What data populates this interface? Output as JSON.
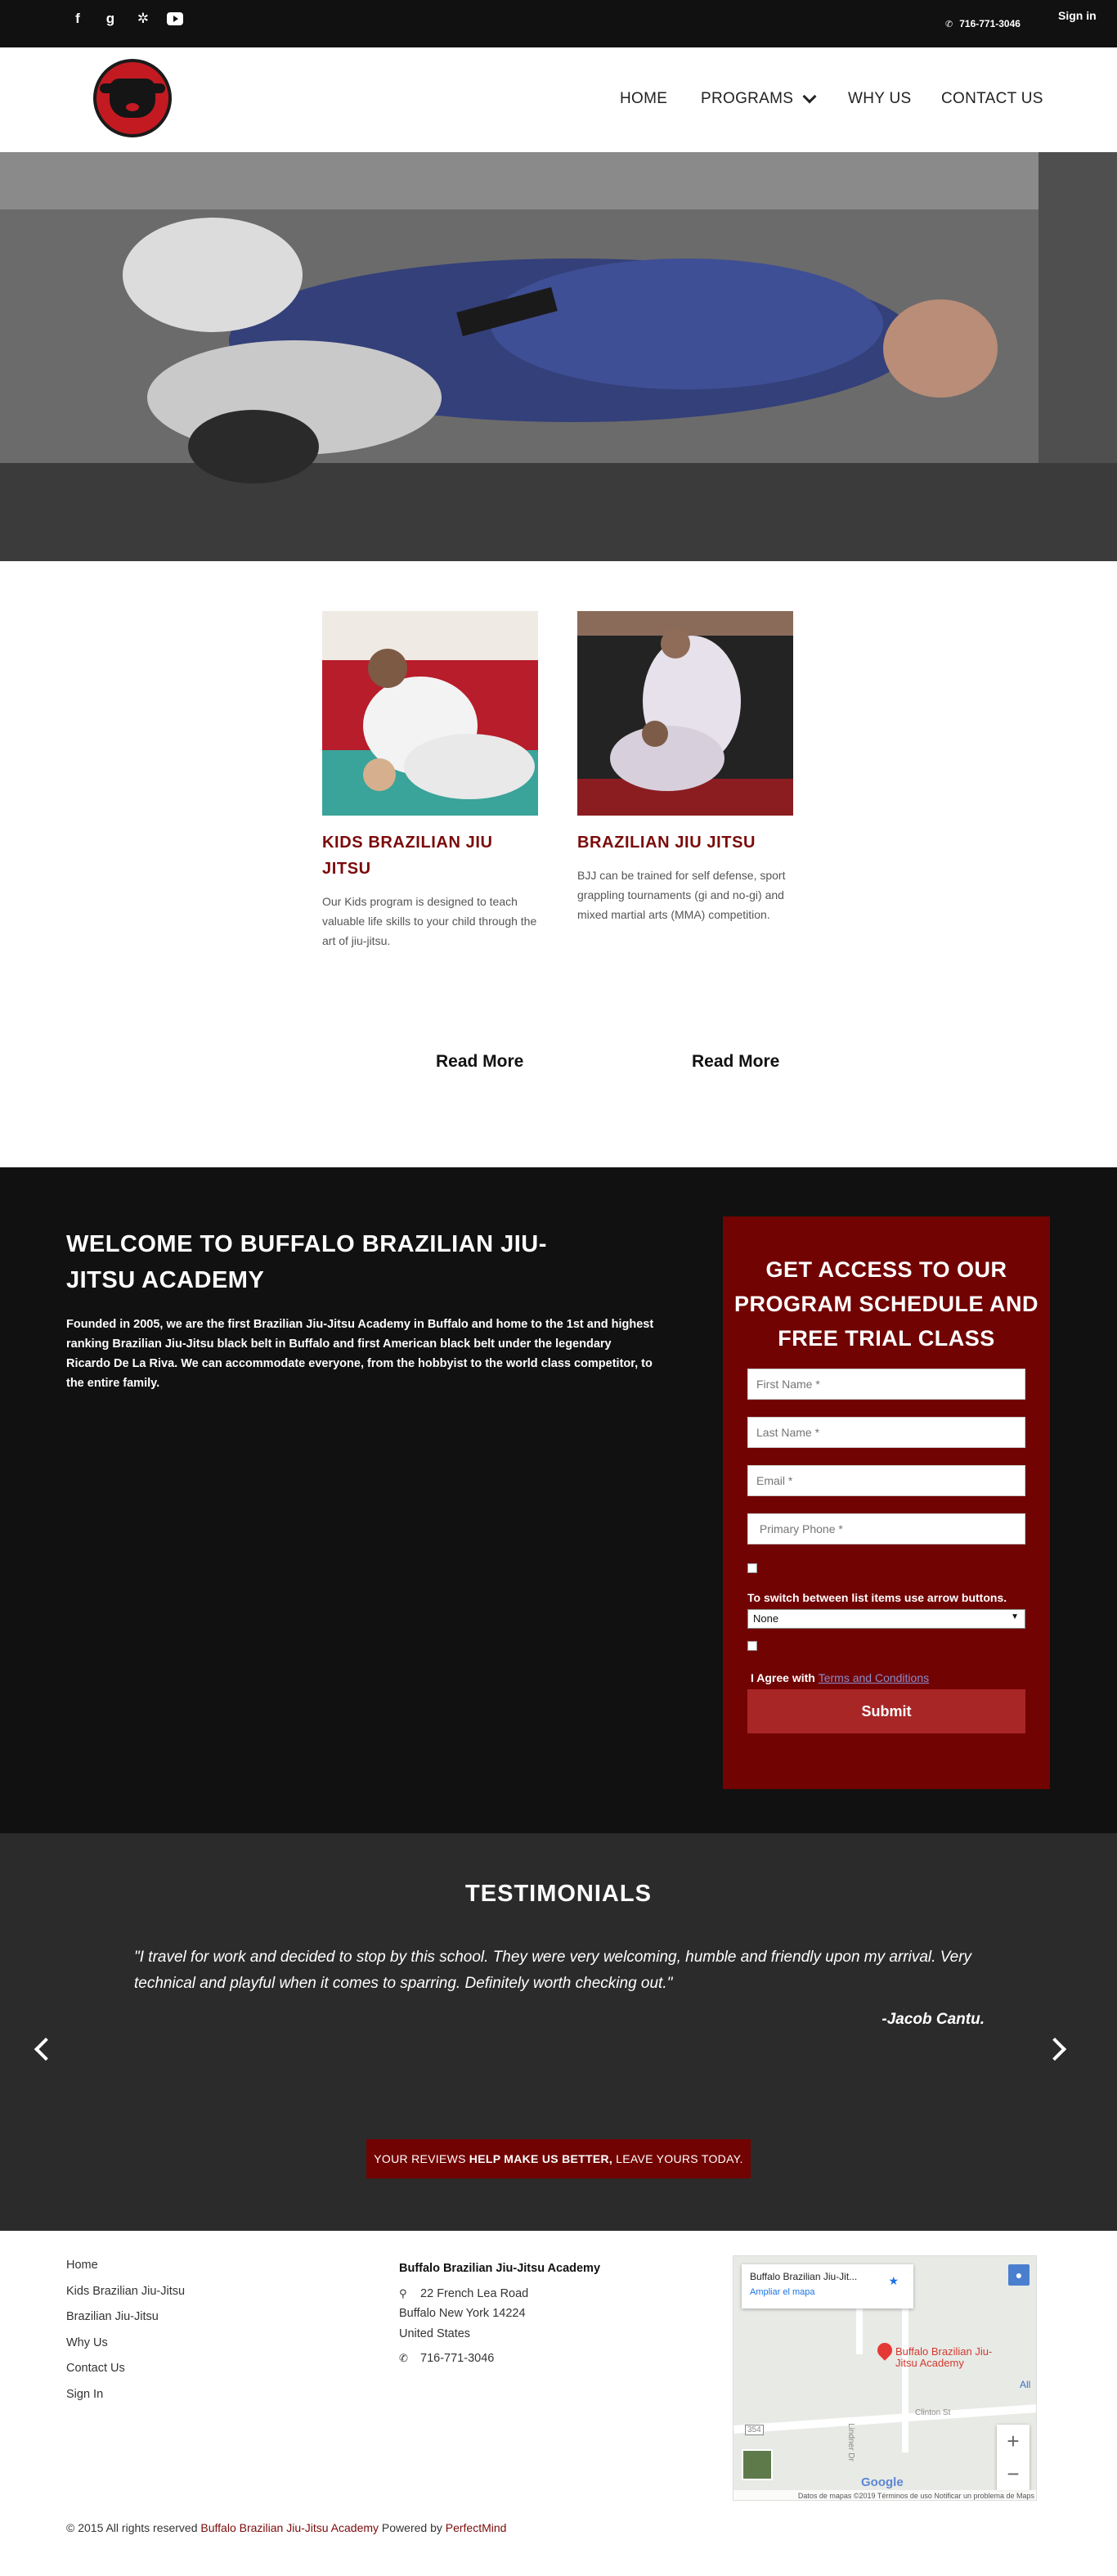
{
  "topbar": {
    "social_icons": [
      "facebook-icon",
      "google-plus-icon",
      "yelp-icon",
      "youtube-icon"
    ],
    "phone": "716-771-3046",
    "sign_in": "Sign in"
  },
  "nav": {
    "home": "HOME",
    "programs": "PROGRAMS",
    "why_us": "WHY US",
    "contact_us": "CONTACT US"
  },
  "programs": [
    {
      "title": "KIDS BRAZILIAN JIU JITSU",
      "text": "Our Kids program is designed to teach valuable life skills to your child through the art of jiu-jitsu.",
      "read_more": "Read More"
    },
    {
      "title": "BRAZILIAN JIU JITSU",
      "text": "BJJ can be trained for self defense, sport grappling tournaments (gi and no-gi) and mixed martial arts (MMA) competition.",
      "read_more": "Read More"
    }
  ],
  "welcome": {
    "title": "WELCOME TO BUFFALO BRAZILIAN JIU-JITSU ACADEMY",
    "text": "Founded in 2005, we are the first Brazilian Jiu-Jitsu Academy in Buffalo and home to the 1st and highest ranking Brazilian Jiu-Jitsu black belt in Buffalo and first American black belt under the legendary Ricardo De La Riva. We can accommodate everyone, from the hobbyist to the world class competitor, to the entire family."
  },
  "form": {
    "title": "GET ACCESS TO OUR PROGRAM SCHEDULE AND FREE TRIAL CLASS",
    "first_name_placeholder": "First Name *",
    "last_name_placeholder": "Last Name *",
    "email_placeholder": "Email *",
    "phone_placeholder": " Primary Phone *",
    "switch_note": "To switch between list items use arrow buttons.",
    "select_value": "None",
    "agree_prefix": "I Agree with",
    "terms_link": "Terms and Conditions",
    "submit": "Submit"
  },
  "testimonials": {
    "title": "TESTIMONIALS",
    "quote": "\"I travel for work and decided to stop by this school. They were very welcoming, humble and friendly upon my arrival. Very technical and playful when it comes to sparring. Definitely worth checking out.\"",
    "author": "-Jacob Cantu.",
    "review_pre": "YOUR REVIEWS",
    "review_bold": "HELP MAKE US BETTER,",
    "review_post": "LEAVE YOURS TODAY."
  },
  "footer": {
    "links": [
      "Home",
      "Kids Brazilian Jiu-Jitsu",
      "Brazilian Jiu-Jitsu",
      "Why Us",
      "Contact Us",
      "Sign In"
    ],
    "org": "Buffalo Brazilian Jiu-Jitsu Academy",
    "street": "22 French Lea Road",
    "city": "Buffalo New York  14224",
    "country": "United States",
    "phone": "716-771-3046",
    "copyright_pre": "© 2015 All rights reserved",
    "copyright_org": "Buffalo Brazilian Jiu-Jitsu Academy",
    "copyright_mid": "Powered by",
    "copyright_brand": "PerfectMind"
  },
  "map": {
    "card_title": "Buffalo Brazilian Jiu-Jit...",
    "enlarge": "Ampliar el mapa",
    "pin_label": "Buffalo Brazilian Jiu-Jitsu Academy",
    "street_label": "Clinton St",
    "street_label_2": "Lindner Dr",
    "route_label": "354",
    "side_label": "All",
    "google": "Google",
    "attribution": "Datos de mapas ©2019   Términos de uso   Notificar un problema de Maps"
  },
  "colors": {
    "accent_red": "#720303",
    "title_red": "#7b0a0a",
    "dark_bg": "#111111",
    "testimonial_bg": "#2b2b2b",
    "submit_red": "#a82626"
  }
}
